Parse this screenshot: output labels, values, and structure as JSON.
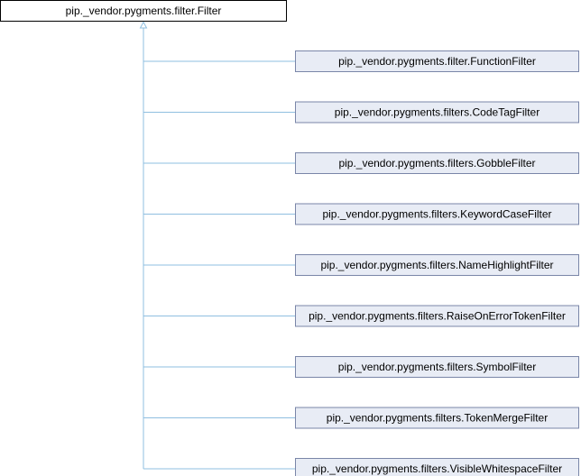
{
  "diagram": {
    "type": "class-inheritance",
    "base_class": {
      "name": "pip._vendor.pygments.filter.Filter",
      "style": {
        "fill": "#ffffff",
        "stroke": "#000000"
      }
    },
    "derived_classes": [
      {
        "name": "pip._vendor.pygments.filter.FunctionFilter"
      },
      {
        "name": "pip._vendor.pygments.filters.CodeTagFilter"
      },
      {
        "name": "pip._vendor.pygments.filters.GobbleFilter"
      },
      {
        "name": "pip._vendor.pygments.filters.KeywordCaseFilter"
      },
      {
        "name": "pip._vendor.pygments.filters.NameHighlightFilter"
      },
      {
        "name": "pip._vendor.pygments.filters.RaiseOnErrorTokenFilter"
      },
      {
        "name": "pip._vendor.pygments.filters.SymbolFilter"
      },
      {
        "name": "pip._vendor.pygments.filters.TokenMergeFilter"
      },
      {
        "name": "pip._vendor.pygments.filters.VisibleWhitespaceFilter"
      }
    ],
    "colors": {
      "derived_fill": "#e8ecf5",
      "derived_stroke": "#7a86a8",
      "edge": "#8fbfe0",
      "text": "#000000"
    }
  }
}
